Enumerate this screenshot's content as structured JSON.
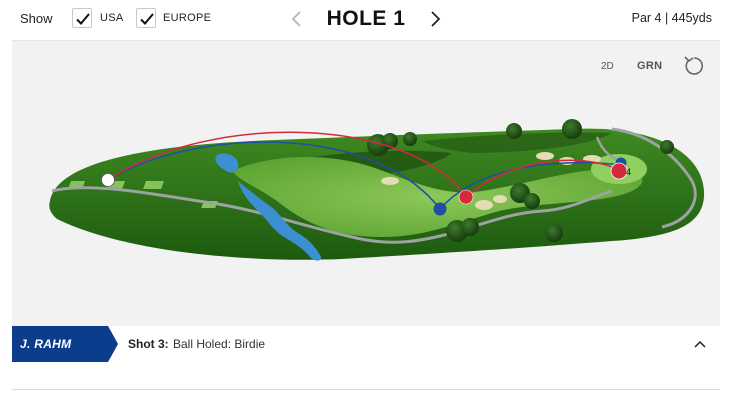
{
  "filters": {
    "show_label": "Show",
    "options": [
      {
        "label": "USA",
        "checked": true
      },
      {
        "label": "EUROPE",
        "checked": true
      }
    ]
  },
  "hole": {
    "title": "HOLE 1",
    "info": "Par 4 | 445yds",
    "prev_icon": "chevron-left-icon",
    "next_icon": "chevron-right-icon"
  },
  "map_controls": {
    "view_2d": "2D",
    "green_view": "GRN",
    "reset_icon": "reset-view-icon"
  },
  "pin_marker": {
    "label": "4"
  },
  "teams": {
    "usa_color": "#1f4fa0",
    "europe_color": "#d42a3c"
  },
  "shot": {
    "player": "J. RAHM",
    "label": "Shot 3:",
    "description": "Ball Holed: Birdie",
    "player_tag_color": "#0b3d8c",
    "collapse_icon": "chevron-up-icon"
  }
}
